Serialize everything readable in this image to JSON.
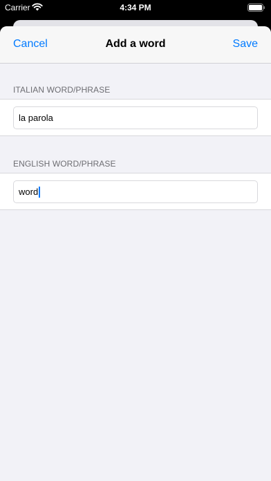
{
  "status_bar": {
    "carrier": "Carrier",
    "time": "4:34 PM"
  },
  "nav": {
    "cancel_label": "Cancel",
    "title": "Add a word",
    "save_label": "Save"
  },
  "form": {
    "italian": {
      "header": "ITALIAN WORD/PHRASE",
      "value": "la parola"
    },
    "english": {
      "header": "ENGLISH WORD/PHRASE",
      "value": "word"
    }
  },
  "colors": {
    "accent": "#007aff",
    "background": "#f2f2f7"
  }
}
